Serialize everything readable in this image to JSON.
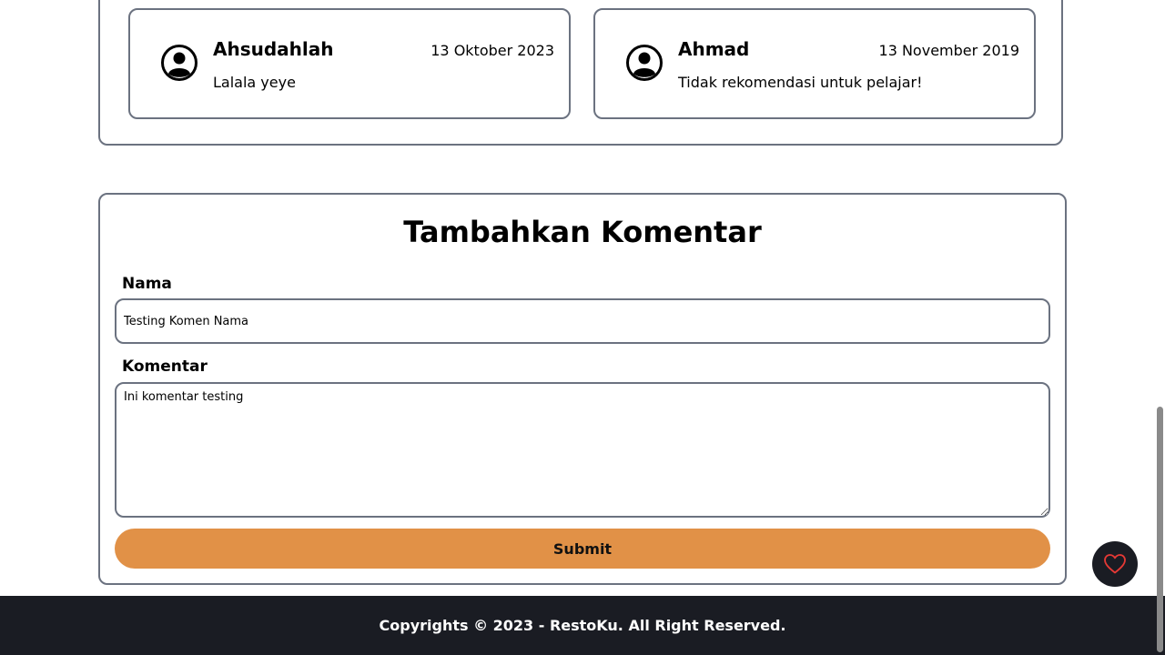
{
  "reviews": [
    {
      "name": "Ahsudahlah",
      "date": "13 Oktober 2023",
      "text": "Lalala yeye"
    },
    {
      "name": "Ahmad",
      "date": "13 November 2019",
      "text": "Tidak rekomendasi untuk pelajar!"
    }
  ],
  "form": {
    "title": "Tambahkan Komentar",
    "name_label": "Nama",
    "name_value": "Testing Komen Nama",
    "comment_label": "Komentar",
    "comment_value": "Ini komentar testing",
    "submit_label": "Submit"
  },
  "footer": {
    "text": "Copyrights © 2023 - RestoKu.  All Right Reserved."
  },
  "icons": {
    "avatar": "user-circle-icon",
    "favorite": "heart-icon"
  },
  "colors": {
    "accent": "#e19147",
    "footer_bg": "#1a1c23",
    "border": "#6b7280",
    "heart": "#e53935"
  }
}
